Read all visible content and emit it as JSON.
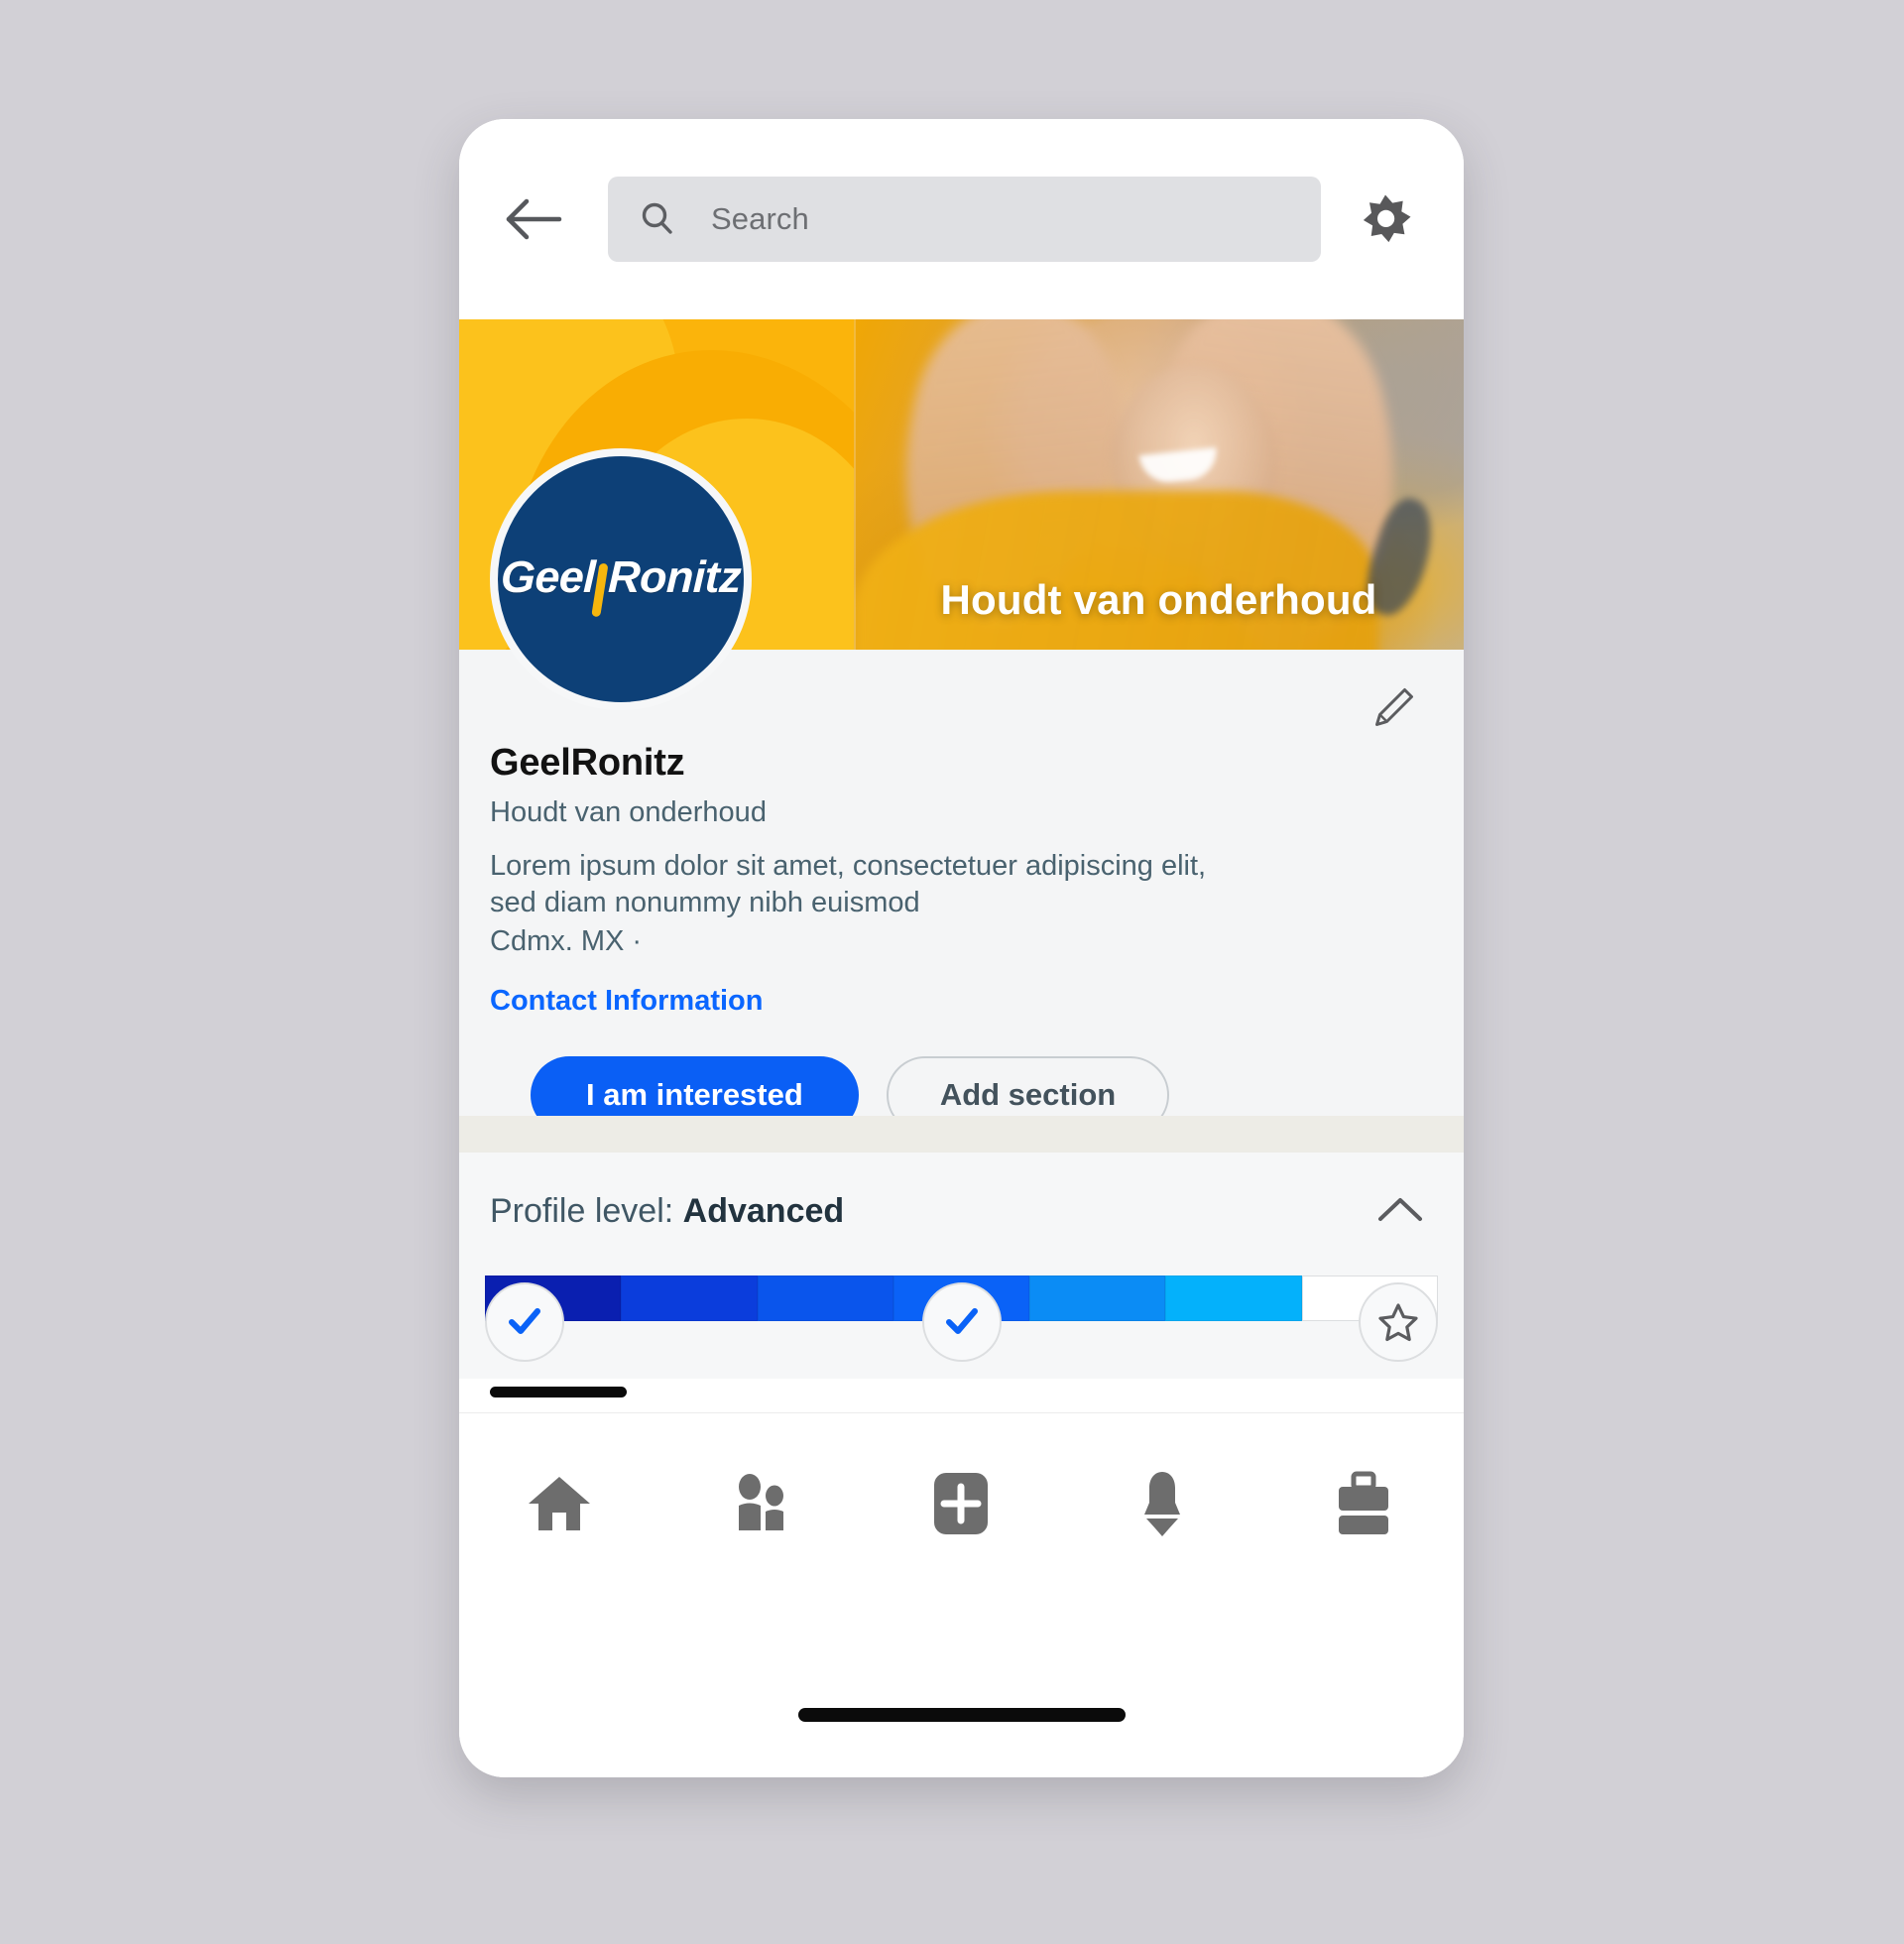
{
  "app": {
    "theme_background": "#d2d0d6",
    "accent_blue": "#0a5ff5",
    "link_blue": "#0a66ff",
    "brand_yellow": "#fbb40b",
    "brand_navy": "#0d4077"
  },
  "topbar": {
    "back_icon": "arrow-left-icon",
    "search": {
      "placeholder": "Search",
      "value": "",
      "icon": "search-icon"
    },
    "settings_icon": "gear-icon"
  },
  "banner": {
    "caption": "Houdt van onderhoud",
    "left_graphic": "yellow-swoosh-graphic",
    "right_photo_alt": "person in yellow jacket making heart shape with hands"
  },
  "profile": {
    "avatar": {
      "logo_part_one": "Geel",
      "logo_part_two": "Ronitz",
      "background_color": "#0d4077",
      "accent_color": "#f6b60d"
    },
    "edit_icon": "pencil-icon",
    "name": "GeelRonitz",
    "tagline": "Houdt van onderhoud",
    "description": "Lorem ipsum dolor sit amet, consectetuer adipiscing elit, sed diam nonummy nibh euismod",
    "location": "Cdmx. MX ·",
    "contact_link": "Contact Information",
    "primary_button": "I am interested",
    "secondary_button": "Add section"
  },
  "level_card": {
    "label_prefix": "Profile level:",
    "level": "Advanced",
    "collapse_icon": "chevron-up-icon",
    "progress": {
      "total_segments": 7,
      "filled_segments": 6,
      "segment_colors": [
        "#0a1fb0",
        "#0b3ddc",
        "#0a55ec",
        "#0a62f7",
        "#0b8cf5",
        "#04b1fb"
      ],
      "empty_color": "#ffffff",
      "milestones": [
        {
          "position": "start",
          "icon": "check-icon",
          "state": "completed"
        },
        {
          "position": "middle",
          "icon": "check-icon",
          "state": "completed"
        },
        {
          "position": "end",
          "icon": "star-icon",
          "state": "pending"
        }
      ]
    }
  },
  "bottom_nav": {
    "items": [
      {
        "name": "home",
        "icon": "home-icon"
      },
      {
        "name": "network",
        "icon": "people-icon"
      },
      {
        "name": "post",
        "icon": "plus-square-icon"
      },
      {
        "name": "notifications",
        "icon": "bell-icon"
      },
      {
        "name": "jobs",
        "icon": "briefcase-icon"
      }
    ]
  }
}
